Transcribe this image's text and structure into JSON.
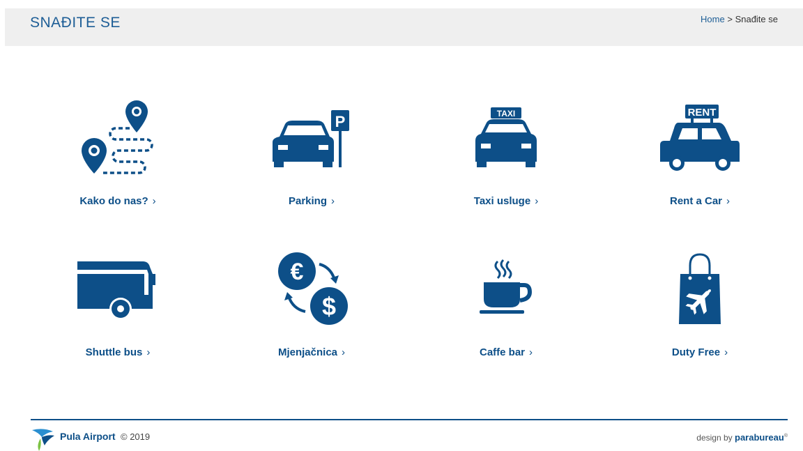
{
  "header": {
    "title": "SNAĐITE SE",
    "breadcrumb": {
      "home": "Home",
      "separator": " > ",
      "current": "Snađite se"
    }
  },
  "tiles": [
    {
      "label": "Kako do nas?",
      "icon": "map-route-icon"
    },
    {
      "label": "Parking",
      "icon": "car-parking-icon"
    },
    {
      "label": "Taxi usluge",
      "icon": "taxi-icon"
    },
    {
      "label": "Rent a Car",
      "icon": "rent-car-icon",
      "badge": "RENT"
    },
    {
      "label": "Shuttle bus",
      "icon": "bus-icon"
    },
    {
      "label": "Mjenjačnica",
      "icon": "currency-exchange-icon"
    },
    {
      "label": "Caffe bar",
      "icon": "coffee-cup-icon"
    },
    {
      "label": "Duty Free",
      "icon": "shopping-bag-plane-icon"
    }
  ],
  "chevron": "›",
  "footer": {
    "brand": "Pula Airport",
    "copyright": "© 2019",
    "credit_prefix": "design by",
    "credit_brand": "parabureau",
    "credit_mark": "®"
  },
  "colors": {
    "primary": "#0d4f88",
    "header_bg": "#efefef"
  }
}
